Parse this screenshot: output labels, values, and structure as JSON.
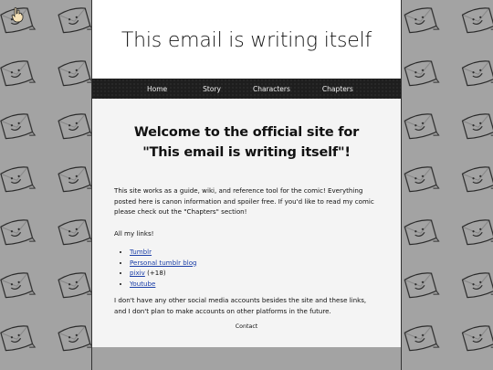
{
  "site": {
    "title": "This email is writing itself"
  },
  "nav": {
    "items": [
      {
        "label": "Home"
      },
      {
        "label": "Story"
      },
      {
        "label": "Characters"
      },
      {
        "label": "Chapters"
      }
    ]
  },
  "main": {
    "welcome_line1": "Welcome to the official site for",
    "welcome_line2": "\"This email is writing itself\"!",
    "intro": "This site works as a guide, wiki, and reference tool for the comic! Everything posted here is canon information and spoiler free. If you'd like to read my comic please check out the \"Chapters\" section!",
    "links_label": "All my links!",
    "links": [
      {
        "label": "Tumblr",
        "note": ""
      },
      {
        "label": "Personal tumblr blog",
        "note": ""
      },
      {
        "label": "pixiv",
        "note": " (+18)"
      },
      {
        "label": "Youtube",
        "note": ""
      }
    ],
    "social_note": "I don't have any other social media accounts besides the site and these links, and I don't plan to make accounts on other platforms in the future.",
    "contact_label": "Contact"
  },
  "colors": {
    "background": "#a3a3a3",
    "pattern_stroke": "#2a2a2a",
    "nav_bar": "#1e1e1e",
    "link": "#1b3fa8"
  },
  "icons": {
    "background_tile": "smiling-envelope-icon",
    "cursor": "hand-cursor-icon"
  }
}
